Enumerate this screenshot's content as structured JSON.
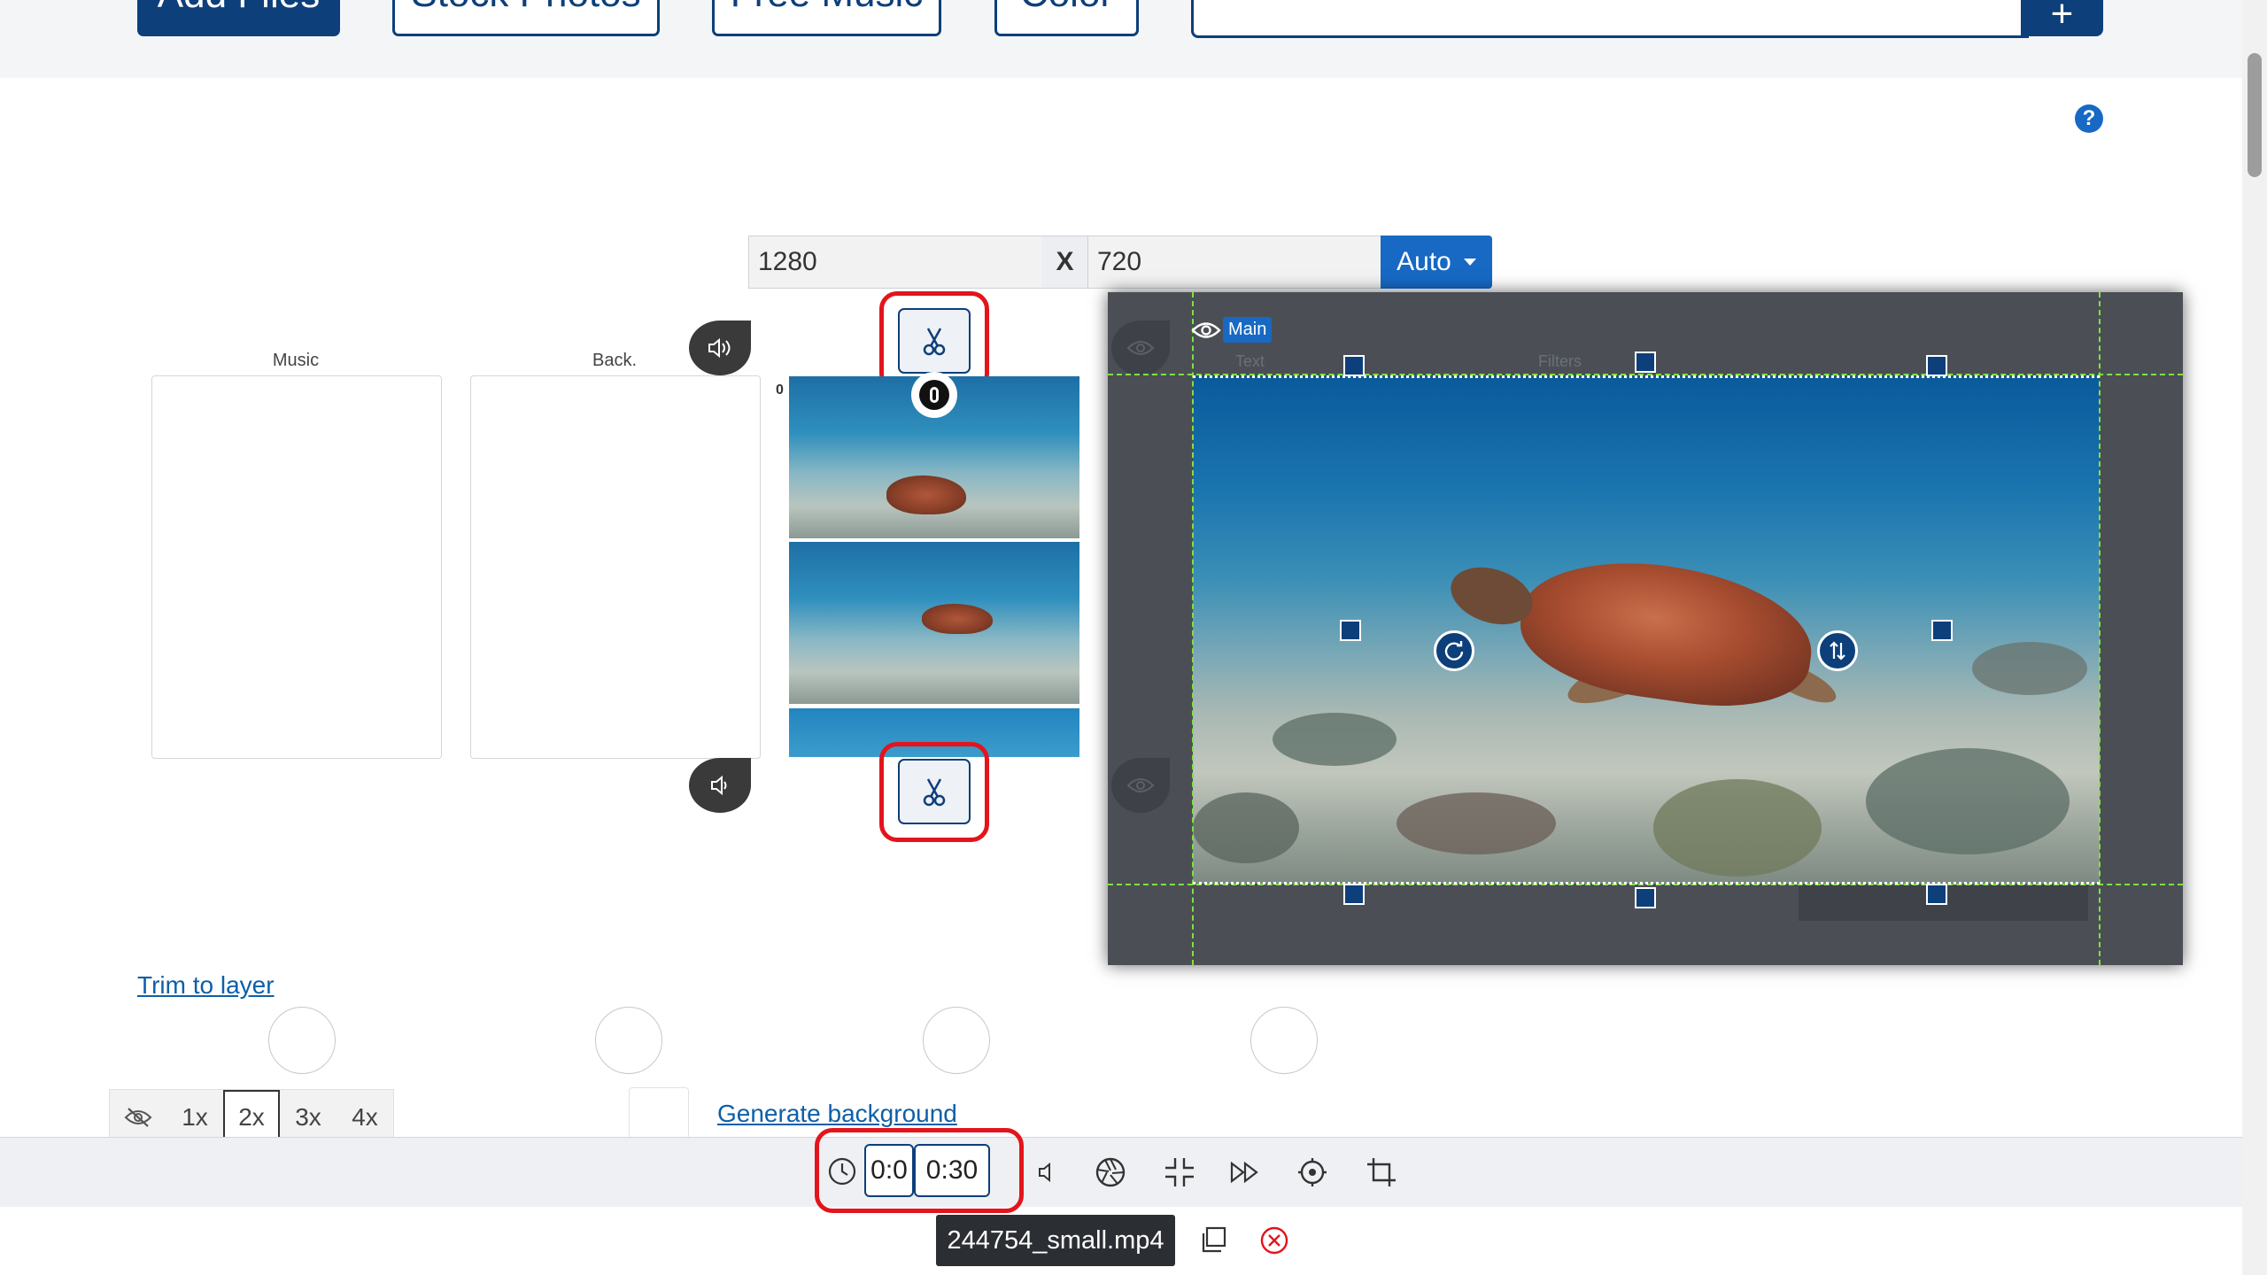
{
  "toolbar": {
    "add_files": "Add Files",
    "stock_photos": "Stock Photos",
    "free_music": "Free Music",
    "color": "Color",
    "plus": "+"
  },
  "help": "?",
  "dimensions": {
    "width": "1280",
    "separator": "X",
    "height": "720",
    "preset": "Auto"
  },
  "tracks": {
    "music_label": "Music",
    "background_label": "Back.",
    "layer_index": "0"
  },
  "preview": {
    "layer_tag": "Main",
    "ghost_text": "Text",
    "ghost_filters": "Filters"
  },
  "links": {
    "trim_to_layer": "Trim to layer",
    "generate_background": "Generate background"
  },
  "zoom": {
    "options": [
      "1x",
      "2x",
      "3x",
      "4x"
    ],
    "active": "2x"
  },
  "bottom": {
    "start_time": "0:0",
    "end_time": "0:30",
    "filename": "244754_small.mp4"
  },
  "colors": {
    "brand": "#0d3f7a",
    "accent": "#1769c4",
    "highlight": "#e3141b",
    "guide": "#7ee23e"
  }
}
